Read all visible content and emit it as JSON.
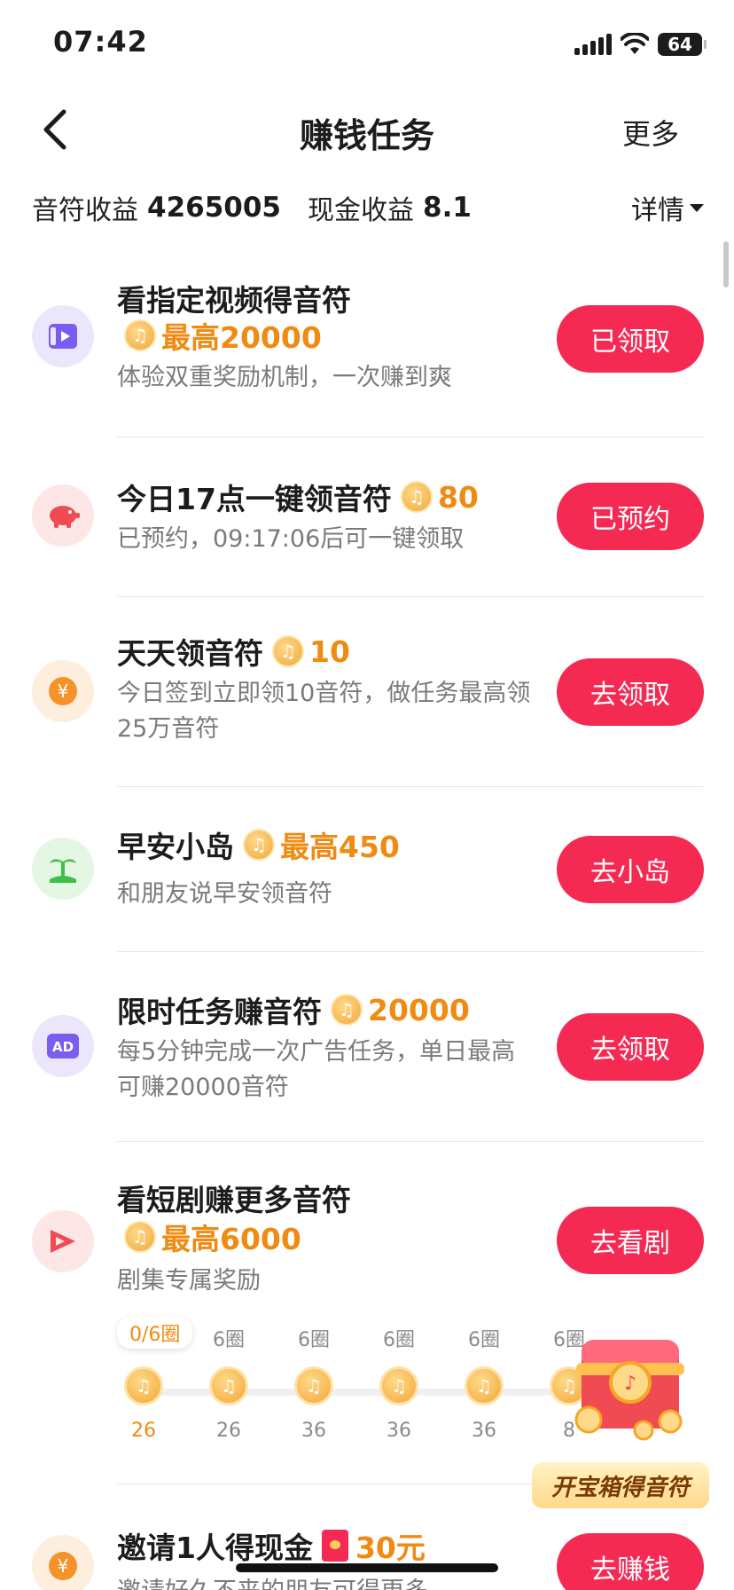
{
  "status_bar": {
    "time": "07:42",
    "battery": "64"
  },
  "nav": {
    "title": "赚钱任务",
    "more": "更多"
  },
  "earnings": {
    "note_label": "音符收益",
    "note_value": "4265005",
    "cash_label": "现金收益",
    "cash_value": "8.1",
    "detail": "详情"
  },
  "tasks": [
    {
      "title": "看指定视频得音符",
      "reward": "最高20000",
      "desc": "体验双重奖励机制，一次赚到爽",
      "button": "已领取",
      "icon": "video-icon",
      "color": "#7b5cf0"
    },
    {
      "title": "今日17点一键领音符",
      "reward": "80",
      "desc": "已预约，09:17:06后可一键领取",
      "button": "已预约",
      "icon": "piggy-bank-icon",
      "color": "#f04a52"
    },
    {
      "title": "天天领音符",
      "reward": "10",
      "desc": "今日签到立即领10音符，做任务最高领25万音符",
      "button": "去领取",
      "icon": "yen-coin-icon",
      "color": "#f5922a"
    },
    {
      "title": "早安小岛",
      "reward": "最高450",
      "desc": "和朋友说早安领音符",
      "button": "去小岛",
      "icon": "island-icon",
      "color": "#3fbf4a"
    },
    {
      "title": "限时任务赚音符",
      "reward": "20000",
      "desc": "每5分钟完成一次广告任务，单日最高可赚20000音符",
      "button": "去领取",
      "icon": "ad-icon",
      "color": "#7b5cf0"
    },
    {
      "title": "看短剧赚更多音符",
      "reward": "最高6000",
      "desc": "剧集专属奖励",
      "button": "去看剧",
      "icon": "play-drama-icon",
      "color": "#f04a52"
    },
    {
      "title": "邀请1人得现金",
      "reward": "30元",
      "desc": "邀请好久不来的朋友可得更多",
      "button": "去赚钱",
      "icon": "yen-coin-icon",
      "color": "#f5922a"
    }
  ],
  "drama_progress": {
    "current_laps": "0/6圈",
    "steps": [
      {
        "laps": "",
        "value": "26"
      },
      {
        "laps": "6圈",
        "value": "26"
      },
      {
        "laps": "6圈",
        "value": "36"
      },
      {
        "laps": "6圈",
        "value": "36"
      },
      {
        "laps": "6圈",
        "value": "36"
      },
      {
        "laps": "6圈",
        "value": "8"
      }
    ]
  },
  "treasure": {
    "label": "开宝箱得音符"
  }
}
